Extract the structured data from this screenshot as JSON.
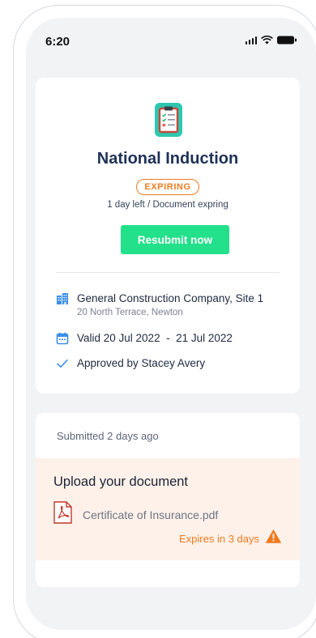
{
  "status_bar": {
    "time": "6:20"
  },
  "document": {
    "title": "National Induction",
    "status_badge": "EXPIRING",
    "expiry_note": "1 day left / Document expring",
    "resubmit_label": "Resubmit now"
  },
  "details": {
    "company": "General Construction Company, Site 1",
    "address": "20 North Terrace, Newton",
    "validity": "Valid 20 Jul 2022  -  21 Jul 2022",
    "approval": "Approved by Stacey Avery"
  },
  "submission": {
    "submitted": "Submitted 2 days ago",
    "upload_title": "Upload your document",
    "file_name": "Certificate of Insurance.pdf",
    "expires": "Expires in 3 days"
  },
  "icons": {
    "document": "clipboard-checklist-icon",
    "company": "building-icon",
    "validity": "calendar-icon",
    "approval": "checkmark-icon",
    "file": "pdf-icon",
    "warning": "warning-icon"
  },
  "colors": {
    "title": "#1f3158",
    "expiring": "#f07b1f",
    "primary_button": "#23e08a",
    "icon_blue": "#3b8fe8",
    "doc_icon": "#2ec7b0",
    "upload_panel": "#fdf1e9",
    "pdf_red": "#c0392b"
  }
}
